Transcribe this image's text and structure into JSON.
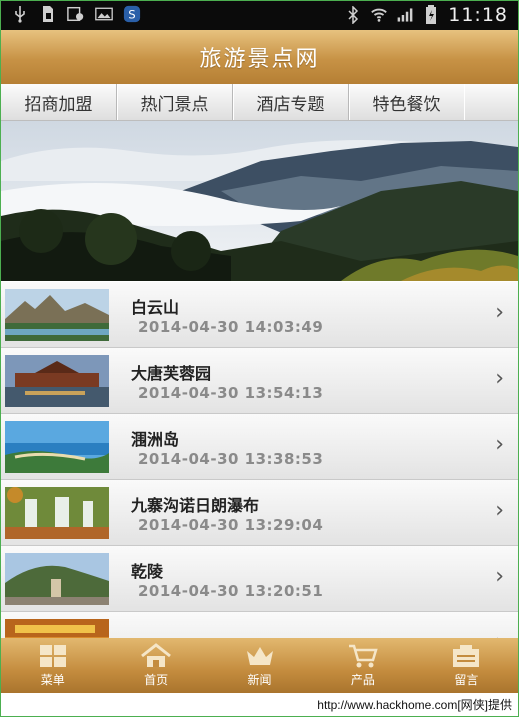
{
  "status_bar": {
    "time": "11:18",
    "left_icons": [
      "usb-icon",
      "sim-icon",
      "gallery-icon",
      "image-icon",
      "app-icon"
    ],
    "right_icons": [
      "bluetooth-icon",
      "wifi-icon",
      "signal-icon",
      "battery-icon"
    ]
  },
  "header": {
    "title": "旅游景点网"
  },
  "tabs": [
    {
      "label": "招商加盟"
    },
    {
      "label": "热门景点"
    },
    {
      "label": "酒店专题"
    },
    {
      "label": "特色餐饮"
    }
  ],
  "list": {
    "items": [
      {
        "name": "白云山",
        "date": "2014-04-30 14:03:49"
      },
      {
        "name": "大唐芙蓉园",
        "date": "2014-04-30 13:54:13"
      },
      {
        "name": "涠洲岛",
        "date": "2014-04-30 13:38:53"
      },
      {
        "name": "九寨沟诺日朗瀑布",
        "date": "2014-04-30 13:29:04"
      },
      {
        "name": "乾陵",
        "date": "2014-04-30 13:20:51"
      }
    ]
  },
  "bottom_nav": [
    {
      "label": "菜单",
      "icon": "menu-grid-icon"
    },
    {
      "label": "首页",
      "icon": "home-icon"
    },
    {
      "label": "新闻",
      "icon": "news-crown-icon"
    },
    {
      "label": "产品",
      "icon": "cart-icon"
    },
    {
      "label": "留言",
      "icon": "message-icon"
    }
  ],
  "watermark": "http://www.hackhome.com[网侠]提供",
  "colors": {
    "accent_gold": "#c79245",
    "status_bar": "#0b0b0b",
    "frame_green": "#4caf50"
  }
}
